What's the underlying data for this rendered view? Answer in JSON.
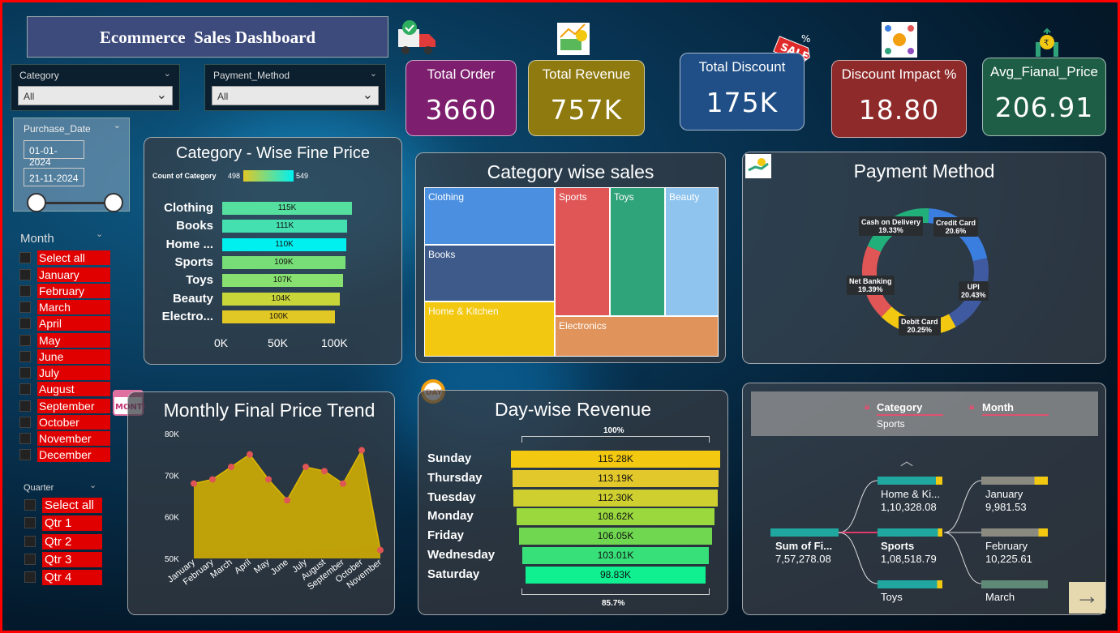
{
  "title": "Ecommerce  Sales Dashboard",
  "slicers": {
    "category": {
      "label": "Category",
      "value": "All"
    },
    "payment": {
      "label": "Payment_Method",
      "value": "All"
    },
    "date": {
      "label": "Purchase_Date",
      "start": "01-01-2024",
      "end": "21-11-2024"
    },
    "month": {
      "label": "Month",
      "items": [
        "Select all",
        "January",
        "February",
        "March",
        "April",
        "May",
        "June",
        "July",
        "August",
        "September",
        "October",
        "November",
        "December"
      ]
    },
    "quarter": {
      "label": "Quarter",
      "items": [
        "Select all",
        "Qtr 1",
        "Qtr 2",
        "Qtr 3",
        "Qtr 4"
      ]
    }
  },
  "kpis": [
    {
      "label": "Total Order",
      "value": "3660",
      "color": "#7e1e6e"
    },
    {
      "label": "Total Revenue",
      "value": "757K",
      "color": "#8f7a10"
    },
    {
      "label": "Total Discount",
      "value": "175K",
      "color": "#1f4f86"
    },
    {
      "label": "Discount Impact %",
      "value": "18.80",
      "color": "#8e2a2a"
    },
    {
      "label": "Avg_Fianal_Price",
      "value": "206.91",
      "color": "#1f5e46"
    }
  ],
  "category_price": {
    "title": "Category - Wise Fine Price",
    "legend_label": "Count of Category",
    "legend_min": "498",
    "legend_max": "549",
    "axis_ticks": [
      "0K",
      "50K",
      "100K"
    ]
  },
  "treemap": {
    "title": "Category wise sales",
    "cells": [
      "Clothing",
      "Sports",
      "Toys",
      "Beauty",
      "Books",
      "Home & Kitchen",
      "Electronics"
    ]
  },
  "payment": {
    "title": "Payment Method"
  },
  "monthly": {
    "title": "Monthly Final Price Trend"
  },
  "daywise": {
    "title": "Day-wise Revenue",
    "top_pct": "100%",
    "bottom_pct": "85.7%"
  },
  "decomp": {
    "filter_category_label": "Category",
    "filter_category_value": "Sports",
    "filter_month_label": "Month",
    "root": {
      "name": "Sum of Fi...",
      "value": "7,57,278.08"
    },
    "level1": [
      {
        "name": "Home & Ki...",
        "value": "1,10,328.08"
      },
      {
        "name": "Sports",
        "value": "1,08,518.79"
      },
      {
        "name": "Toys",
        "value": ""
      }
    ],
    "level2": [
      {
        "name": "January",
        "value": "9,981.53"
      },
      {
        "name": "February",
        "value": "10,225.61"
      },
      {
        "name": "March",
        "value": ""
      }
    ]
  },
  "chart_data": [
    {
      "type": "bar",
      "title": "Category - Wise Fine Price",
      "orientation": "horizontal",
      "categories": [
        "Clothing",
        "Books",
        "Home ...",
        "Sports",
        "Toys",
        "Beauty",
        "Electro..."
      ],
      "values": [
        115,
        111,
        110,
        109,
        107,
        104,
        100
      ],
      "labels": [
        "115K",
        "111K",
        "110K",
        "109K",
        "107K",
        "104K",
        "100K"
      ],
      "colors": [
        "#55e0a0",
        "#45e0b0",
        "#00f0f0",
        "#77dd77",
        "#88e070",
        "#c9d63a",
        "#e2c824"
      ],
      "xlim": [
        0,
        115
      ]
    },
    {
      "type": "treemap",
      "title": "Category wise sales",
      "categories": [
        "Clothing",
        "Books",
        "Home & Kitchen",
        "Sports",
        "Toys",
        "Beauty",
        "Electronics"
      ],
      "colors": [
        "#4a8fe0",
        "#3d5a8a",
        "#f2c811",
        "#e05555",
        "#2fa37a",
        "#8fc4ef",
        "#e0935a"
      ]
    },
    {
      "type": "pie",
      "title": "Payment Method",
      "labels": [
        "Credit Card",
        "UPI",
        "Debit Card",
        "Net Banking",
        "Cash on Delivery"
      ],
      "values": [
        20.6,
        20.43,
        20.25,
        19.39,
        19.33
      ],
      "value_labels": [
        "20.6%",
        "20.43%",
        "20.25%",
        "19.39%",
        "19.33%"
      ],
      "colors": [
        "#3a7ee0",
        "#3f5aa0",
        "#f2c811",
        "#e05555",
        "#22b07a"
      ]
    },
    {
      "type": "area",
      "title": "Monthly Final Price Trend",
      "categories": [
        "January",
        "February",
        "March",
        "April",
        "May",
        "June",
        "July",
        "August",
        "September",
        "October",
        "November"
      ],
      "values": [
        68,
        69,
        72,
        75,
        69,
        64,
        72,
        71,
        68,
        76,
        52
      ],
      "yticks": [
        "50K",
        "60K",
        "70K",
        "80K"
      ],
      "ylim": [
        50,
        80
      ],
      "color": "#d9b400"
    },
    {
      "type": "bar",
      "title": "Day-wise Revenue",
      "orientation": "funnel",
      "categories": [
        "Sunday",
        "Thursday",
        "Tuesday",
        "Monday",
        "Friday",
        "Wednesday",
        "Saturday"
      ],
      "values": [
        115.28,
        113.19,
        112.3,
        108.62,
        106.05,
        103.01,
        98.83
      ],
      "labels": [
        "115.28K",
        "113.19K",
        "112.30K",
        "108.62K",
        "106.05K",
        "103.01K",
        "98.83K"
      ],
      "colors": [
        "#f2c811",
        "#e2c82a",
        "#cfd030",
        "#9ad83e",
        "#70d850",
        "#38e07a",
        "#10f090"
      ]
    }
  ]
}
